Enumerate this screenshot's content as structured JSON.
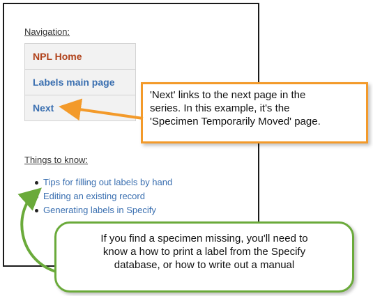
{
  "navigation": {
    "heading": "Navigation:",
    "items": [
      {
        "label": "NPL Home"
      },
      {
        "label": "Labels main page"
      },
      {
        "label": "Next"
      }
    ]
  },
  "things_to_know": {
    "heading": "Things to know:",
    "links": [
      {
        "label": "Tips for filling out labels by hand"
      },
      {
        "label": "Editing an existing record"
      },
      {
        "label": "Generating labels in Specify"
      }
    ]
  },
  "callouts": {
    "next_note": {
      "line1": "'Next' links to the next page in the",
      "line2": "series. In this example, it's the",
      "line3": "'Specimen Temporarily Moved' page."
    },
    "missing_note": {
      "line1": "If you find a specimen missing, you'll need to",
      "line2": "know a how to print a label from the Specify",
      "line3": "database, or how to write out a manual"
    }
  },
  "colors": {
    "link": "#3a6fb0",
    "home_link": "#b0421b",
    "orange_callout": "#f39a2a",
    "green_callout": "#6aaa3a"
  }
}
